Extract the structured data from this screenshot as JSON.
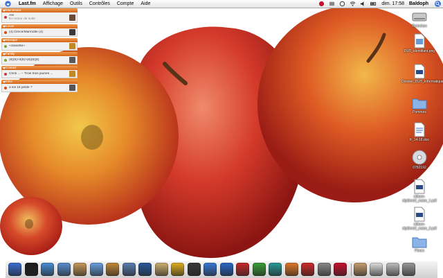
{
  "menubar": {
    "app": "Last.fm",
    "menus": [
      "Affichage",
      "Outils",
      "Contrôles",
      "Compte",
      "Aide"
    ],
    "clock": "dim. 17:58",
    "user": "Baldoph"
  },
  "widgets": [
    {
      "header": "Maintenant",
      "line1": "Aïe",
      "line2": "En retour de suite",
      "dot": "#c13b3b",
      "thumb": "#6a4a3a"
    },
    {
      "header": "Lucas",
      "line1": "(4) Grèce/Marmotte (4)",
      "line2": "",
      "dot": "#d24b1a",
      "thumb": "#3a3a3a"
    },
    {
      "header": "Musique",
      "line1": "«claviette»",
      "line2": "",
      "dot": "#7aa63a",
      "thumb": "#c08a2a"
    },
    {
      "header": "Family",
      "line1": "(8)(9)>3(8)>(8)(9)(8)",
      "line2": "",
      "dot": "#7aa63a",
      "thumb": "#5a5a5a"
    },
    {
      "header": "Contact",
      "line1": "Chris ... – Trois trois jaunes ...",
      "line2": "",
      "dot": "#c13b3b",
      "thumb": "#c08a2a"
    },
    {
      "header": "Infos",
      "line1": "à lidi 16 petite ?",
      "line2": "",
      "dot": "#d24b1a",
      "thumb": "#555555"
    }
  ],
  "desktop_icons": [
    {
      "label": "Romchon",
      "icon": "hard-drive-icon"
    },
    {
      "label": "DUT_identifiant.png",
      "icon": "image-file-icon"
    },
    {
      "label": "Dossier_DUT_Informatique_Lyon.pdf",
      "icon": "pdf-file-icon"
    },
    {
      "label": "Pommes",
      "icon": "folder-icon"
    },
    {
      "label": "fr_14-18.doc",
      "icon": "document-file-icon"
    },
    {
      "label": "0782192",
      "icon": "cd-icon"
    },
    {
      "label": "clôture-diplôme2_exam_1.pdf",
      "icon": "pdf-file-icon"
    },
    {
      "label": "clôture-diplôme2_exam_2.pdf",
      "icon": "pdf-file-icon"
    },
    {
      "label": "Fleurs",
      "icon": "folder-icon"
    }
  ],
  "dock_items": [
    {
      "name": "finder-icon",
      "color": "#3b6fd1"
    },
    {
      "name": "dashboard-icon",
      "color": "#1c1c1c"
    },
    {
      "name": "safari-icon",
      "color": "#4a8fd8"
    },
    {
      "name": "mail-icon",
      "color": "#5b8ed0"
    },
    {
      "name": "address-book-icon",
      "color": "#c99a5a"
    },
    {
      "name": "itunes-icon",
      "color": "#6aa0e0"
    },
    {
      "name": "garageband-icon",
      "color": "#c48a3a"
    },
    {
      "name": "iphoto-icon",
      "color": "#5a7fb0"
    },
    {
      "name": "photoshop-icon",
      "color": "#2a5a9a"
    },
    {
      "name": "preview-icon",
      "color": "#d0b070"
    },
    {
      "name": "chat-icon",
      "color": "#e0b020"
    },
    {
      "name": "imovie-icon",
      "color": "#3a3a3a"
    },
    {
      "name": "quicktime-icon",
      "color": "#3a7ad8"
    },
    {
      "name": "app-icon-blue",
      "color": "#2a6ac8"
    },
    {
      "name": "app-icon-red",
      "color": "#c82a2a"
    },
    {
      "name": "app-icon-green",
      "color": "#3aa03a"
    },
    {
      "name": "app-icon-teal",
      "color": "#2a9a9a"
    },
    {
      "name": "app-icon-orange",
      "color": "#e07a2a"
    },
    {
      "name": "stop-icon",
      "color": "#d02a2a"
    },
    {
      "name": "app-icon-grey",
      "color": "#8a8a8a"
    },
    {
      "name": "lastfm-icon",
      "color": "#c8102e"
    },
    {
      "name": "home-folder-icon",
      "color": "#c8a070"
    },
    {
      "name": "documents-icon",
      "color": "#e0e0e0"
    },
    {
      "name": "applications-icon",
      "color": "#c0c0c0"
    },
    {
      "name": "trash-icon",
      "color": "#9a9a9a"
    }
  ]
}
